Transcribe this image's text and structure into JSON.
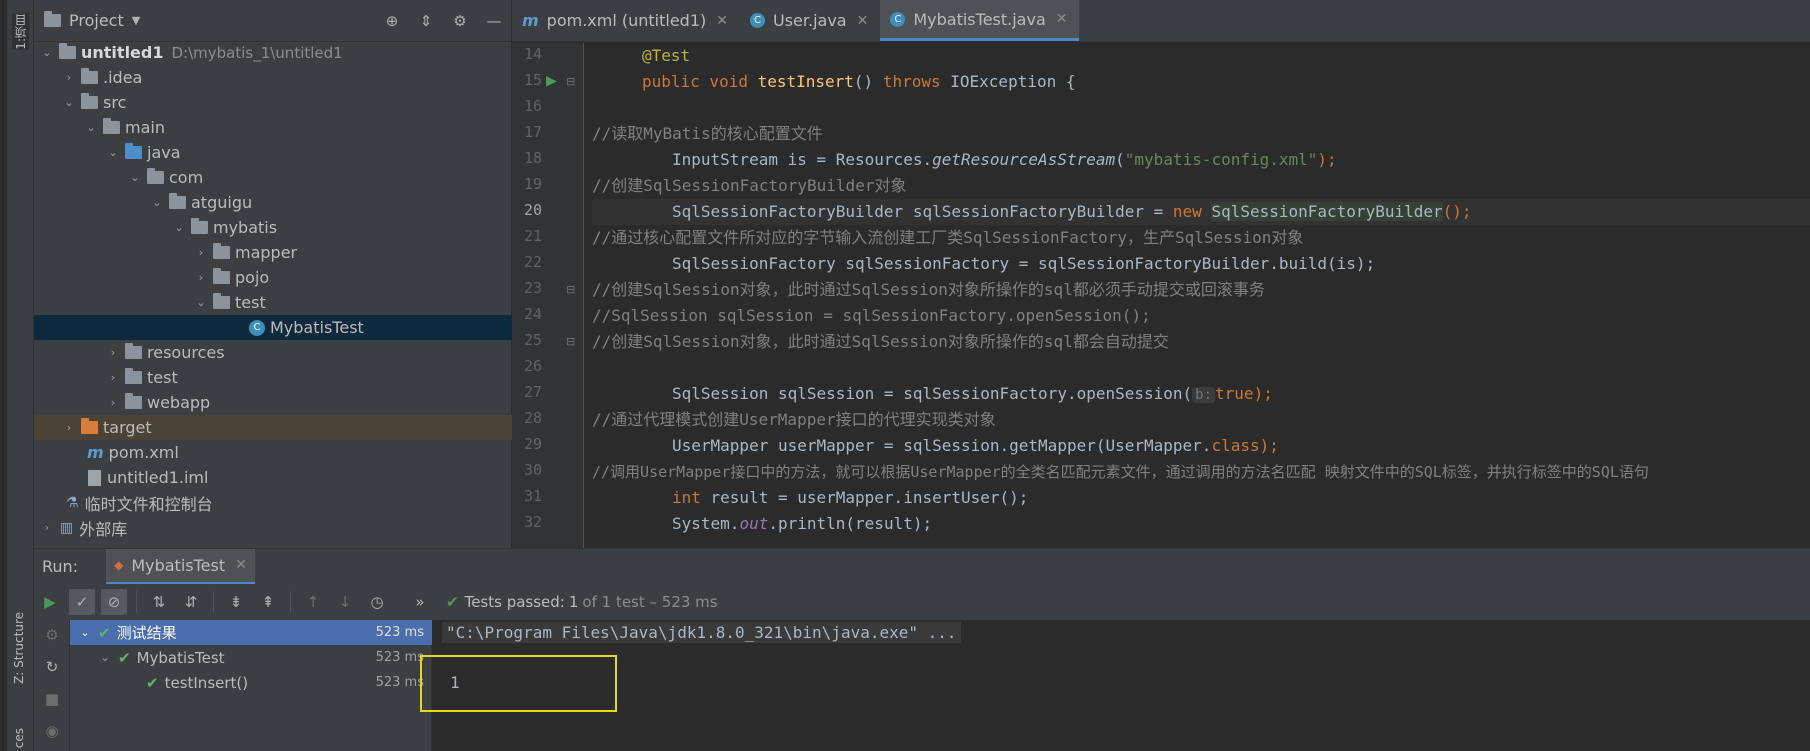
{
  "left_strip": {
    "project_tab": "1:项目",
    "structure_tab": "Z: Structure",
    "bottom_tab": "ces"
  },
  "project_panel": {
    "title": "Project",
    "tree": [
      {
        "label": "untitled1",
        "path": "D:\\mybatis_1\\untitled1"
      },
      {
        "label": ".idea"
      },
      {
        "label": "src"
      },
      {
        "label": "main"
      },
      {
        "label": "java"
      },
      {
        "label": "com"
      },
      {
        "label": "atguigu"
      },
      {
        "label": "mybatis"
      },
      {
        "label": "mapper"
      },
      {
        "label": "pojo"
      },
      {
        "label": "test"
      },
      {
        "label": "MybatisTest"
      },
      {
        "label": "resources"
      },
      {
        "label": "test"
      },
      {
        "label": "webapp"
      },
      {
        "label": "target"
      },
      {
        "label": "pom.xml"
      },
      {
        "label": "untitled1.iml"
      },
      {
        "label": "临时文件和控制台"
      },
      {
        "label": "外部库"
      }
    ]
  },
  "editor_tabs": [
    {
      "label": "pom.xml (untitled1)"
    },
    {
      "label": "User.java"
    },
    {
      "label": "MybatisTest.java"
    }
  ],
  "editor": {
    "line_numbers": [
      "14",
      "15",
      "16",
      "17",
      "18",
      "19",
      "20",
      "21",
      "22",
      "23",
      "24",
      "25",
      "26",
      "27",
      "28",
      "29",
      "30",
      "31",
      "32"
    ],
    "lines": {
      "l14": "@Test",
      "l15_kw": "public void ",
      "l15_fn": "testInsert",
      "l15_rest": "() ",
      "l15_throws": "throws ",
      "l15_ex": "IOException {",
      "l17": "//读取MyBatis的核心配置文件",
      "l18_a": "InputStream is = Resources.",
      "l18_b": "getResourceAsStream",
      "l18_c": "(",
      "l18_str": "\"mybatis-config.xml\"",
      "l18_d": ");",
      "l19": "//创建SqlSessionFactoryBuilder对象",
      "l20_a": "SqlSessionFactoryBuilder sqlSessionFactoryBuilder = ",
      "l20_new": "new ",
      "l20_b": "SqlSessionFactoryBuilder",
      "l20_c": "();",
      "l21": "//通过核心配置文件所对应的字节输入流创建工厂类SqlSessionFactory，生产SqlSession对象",
      "l22": "SqlSessionFactory sqlSessionFactory = sqlSessionFactoryBuilder.build(is);",
      "l23": "//创建SqlSession对象，此时通过SqlSession对象所操作的sql都必须手动提交或回滚事务",
      "l24": "//SqlSession sqlSession = sqlSessionFactory.openSession();",
      "l25": "//创建SqlSession对象，此时通过SqlSession对象所操作的sql都会自动提交",
      "l27_a": "SqlSession sqlSession = sqlSessionFactory.openSession(",
      "l27_hint": "b:",
      "l27_true": "true",
      "l27_b": ");",
      "l28": "//通过代理模式创建UserMapper接口的代理实现类对象",
      "l29_a": "UserMapper userMapper = sqlSession.getMapper(UserMapper.",
      "l29_cls": "class",
      "l29_b": ");",
      "l30": "//调用UserMapper接口中的方法，就可以根据UserMapper的全类名匹配元素文件，通过调用的方法名匹配 映射文件中的SQL标签，并执行标签中的SQL语句",
      "l31_int": "int ",
      "l31_rest": "result = userMapper.insertUser();",
      "l32_a": "System.",
      "l32_out": "out",
      "l32_b": ".println(result);"
    }
  },
  "run_panel": {
    "label": "Run:",
    "tab": "MybatisTest",
    "status_prefix": "Tests passed:",
    "status_count": "1",
    "status_suffix": "of 1 test – 523 ms",
    "tests": [
      {
        "label": "测试结果",
        "duration": "523 ms"
      },
      {
        "label": "MybatisTest",
        "duration": "523 ms"
      },
      {
        "label": "testInsert()",
        "duration": "523 ms"
      }
    ],
    "console_cmd": "\"C:\\Program Files\\Java\\jdk1.8.0_321\\bin\\java.exe\" ...",
    "console_output": "1"
  },
  "colors": {
    "accent": "#4a88c7",
    "success": "#499c54",
    "highlight_box": "#e8d90f"
  }
}
